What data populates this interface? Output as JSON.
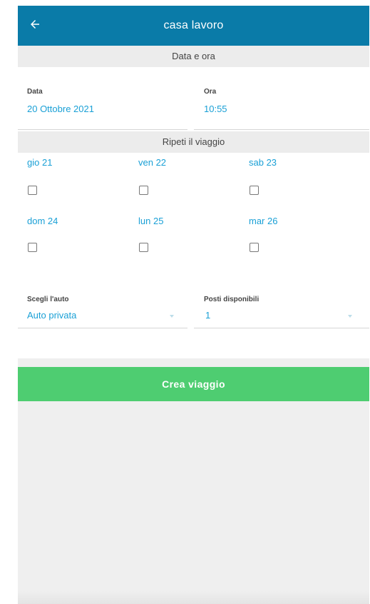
{
  "header": {
    "title": "casa lavoro",
    "back_icon": "arrow-left-icon"
  },
  "sections": {
    "datetime_title": "Data e ora",
    "repeat_title": "Ripeti il viaggio"
  },
  "datetime": {
    "date_label": "Data",
    "date_value": "20 Ottobre 2021",
    "time_label": "Ora",
    "time_value": "10:55"
  },
  "repeat_days": [
    {
      "label": "gio 21",
      "checked": false
    },
    {
      "label": "ven 22",
      "checked": false
    },
    {
      "label": "sab 23",
      "checked": false
    },
    {
      "label": "dom 24",
      "checked": false
    },
    {
      "label": "lun 25",
      "checked": false
    },
    {
      "label": "mar 26",
      "checked": false
    }
  ],
  "car": {
    "car_label": "Scegli l'auto",
    "car_value": "Auto privata",
    "seats_label": "Posti disponibili",
    "seats_value": "1"
  },
  "actions": {
    "create_label": "Crea viaggio"
  },
  "colors": {
    "appbar": "#0a7ba8",
    "accent_text": "#1aa0d6",
    "create_button": "#4ecd71"
  }
}
